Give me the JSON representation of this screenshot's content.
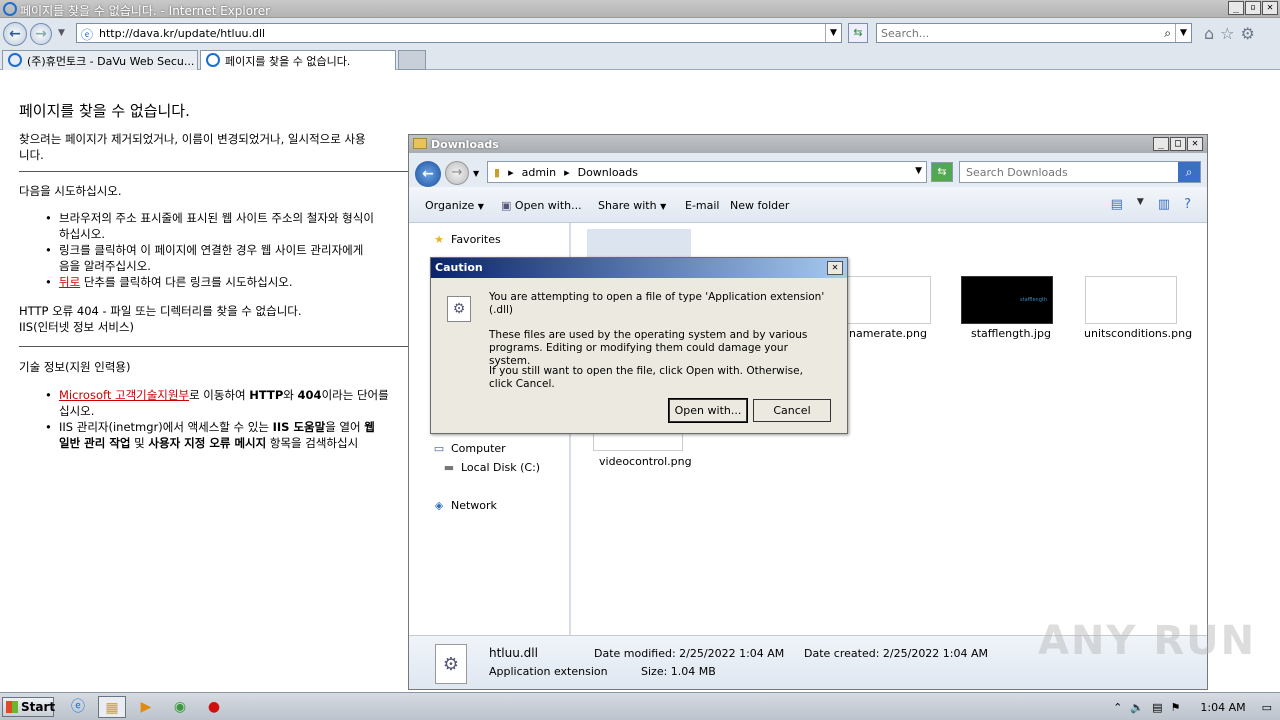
{
  "ie": {
    "title": "페이지를 찾을 수 없습니다. - Internet Explorer",
    "url": "http://dava.kr/update/htluu.dll",
    "search_placeholder": "Search...",
    "tabs": [
      {
        "label": "(주)휴먼토크 - DaVu Web Secu..."
      },
      {
        "label": "페이지를 찾을 수 없습니다."
      }
    ]
  },
  "page": {
    "heading": "페이지를 찾을 수 없습니다.",
    "intro": "찾으려는 페이지가 제거되었거나, 이름이 변경되었거나, 일시적으로 사용",
    "intro2": "니다.",
    "try_heading": "다음을 시도하십시오.",
    "tips": [
      {
        "line1": "브라우저의 주소 표시줄에 표시된 웹 사이트 주소의 철자와 형식이",
        "line2": "하십시오."
      },
      {
        "line1": "링크를 클릭하여 이 페이지에 연결한 경우 웹 사이트 관리자에게",
        "line2": "음을 알려주십시오."
      },
      {
        "link": "뒤로",
        "rest": " 단추를 클릭하여 다른 링크를 시도하십시오."
      }
    ],
    "error_line": "HTTP 오류 404 - 파일 또는 디렉터리를 찾을 수 없습니다.",
    "iis_line": "IIS(인터넷 정보 서비스)",
    "tech_heading": "기술 정보(지원 인력용)",
    "tech": {
      "item1_link": "Microsoft 고객기술지원부",
      "item1_a": "로 이동하여 ",
      "item1_b": "HTTP",
      "item1_c": "와 ",
      "item1_d": "404",
      "item1_e": "이라는 단어를",
      "item1_line2": "십시오.",
      "item2_a": "IIS 관리자(inetmgr)에서 액세스할 수 있는 ",
      "item2_b": "IIS 도움말",
      "item2_c": "을 열어 ",
      "item2_d": "웹",
      "item2_line2_b": "일반 관리 작업",
      "item2_line2_c": " 및 ",
      "item2_line2_d": "사용자 지정 오류 메시지",
      "item2_line2_e": " 항목을 검색하십시"
    }
  },
  "explorer": {
    "title": "Downloads",
    "crumbs": [
      "admin",
      "Downloads"
    ],
    "search_placeholder": "Search Downloads",
    "toolbar": {
      "organize": "Organize",
      "open_with": "Open with...",
      "share_with": "Share with",
      "email": "E-mail",
      "new_folder": "New folder"
    },
    "nav": {
      "favorites": "Favorites",
      "computer": "Computer",
      "local_disk": "Local Disk (C:)",
      "network": "Network"
    },
    "files": {
      "f1": "namerate.png",
      "f2": "stafflength.jpg",
      "f3": "unitsconditions.png",
      "f4": "videocontrol.png",
      "f2_thumb_text": "stafflength"
    },
    "details": {
      "name": "htluu.dll",
      "type": "Application extension",
      "modified_label": "Date modified:",
      "modified": "2/25/2022 1:04 AM",
      "created_label": "Date created:",
      "created": "2/25/2022 1:04 AM",
      "size_label": "Size:",
      "size": "1.04 MB"
    }
  },
  "dialog": {
    "title": "Caution",
    "line1": "You are attempting to open a file of type 'Application extension' (.dll)",
    "line2": "These files are used by the operating system and by various programs. Editing or modifying them could damage your system.",
    "line3": "If you still want to open the file, click Open with. Otherwise, click Cancel.",
    "open_with": "Open with...",
    "cancel": "Cancel"
  },
  "taskbar": {
    "start": "Start",
    "time": "1:04 AM"
  },
  "watermark": "ANY RUN"
}
